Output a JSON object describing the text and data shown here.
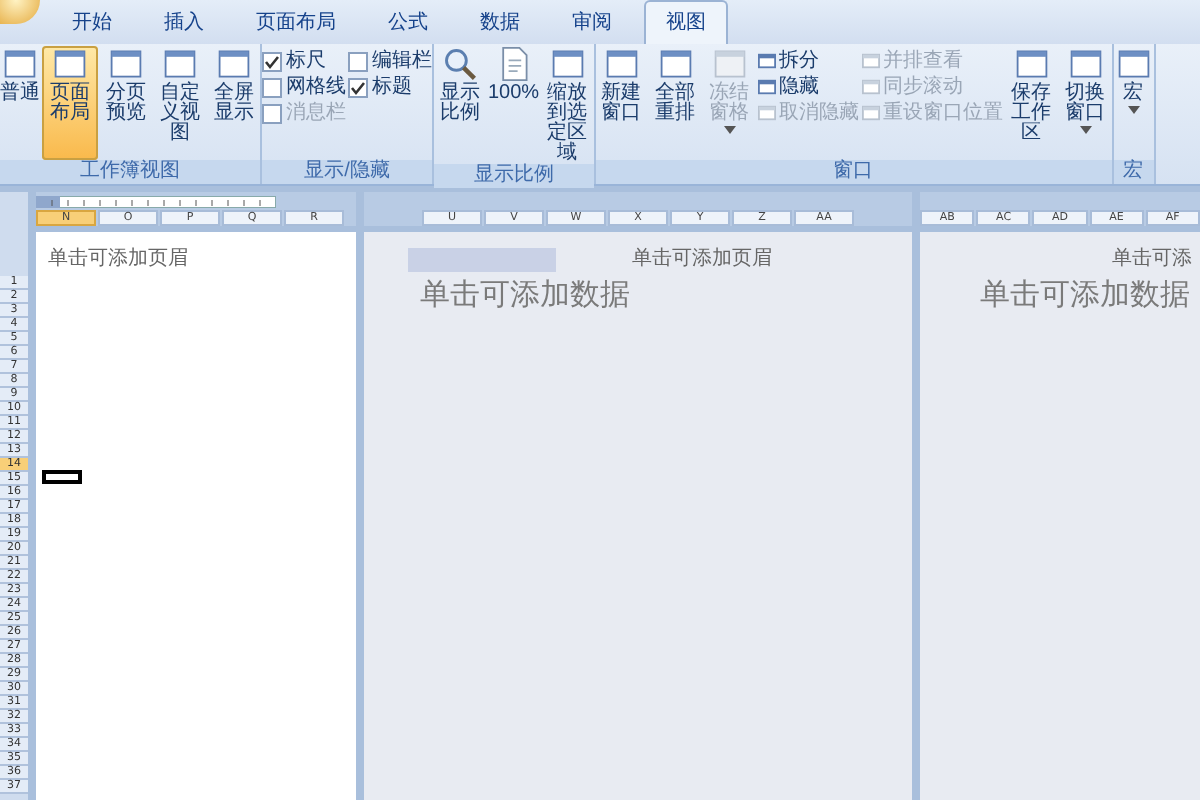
{
  "tabs": [
    {
      "label": "开始",
      "selected": false
    },
    {
      "label": "插入",
      "selected": false
    },
    {
      "label": "页面布局",
      "selected": false
    },
    {
      "label": "公式",
      "selected": false
    },
    {
      "label": "数据",
      "selected": false
    },
    {
      "label": "审阅",
      "selected": false
    },
    {
      "label": "视图",
      "selected": true
    }
  ],
  "ribbon": {
    "groups": [
      {
        "title": "工作簿视图",
        "items": [
          {
            "kind": "large",
            "label": "普通",
            "selected": false,
            "disabled": false
          },
          {
            "kind": "large",
            "label": "页面布局",
            "selected": true,
            "disabled": false
          },
          {
            "kind": "large",
            "label": "分页预览",
            "selected": false,
            "disabled": false
          },
          {
            "kind": "large",
            "label": "自定义视图",
            "selected": false,
            "disabled": false
          },
          {
            "kind": "large",
            "label": "全屏显示",
            "selected": false,
            "disabled": false
          }
        ]
      },
      {
        "title": "显示/隐藏",
        "items": [
          {
            "kind": "checks",
            "entries": [
              {
                "label": "标尺",
                "checked": true,
                "disabled": false
              },
              {
                "label": "网格线",
                "checked": false,
                "disabled": false
              },
              {
                "label": "消息栏",
                "checked": false,
                "disabled": true
              }
            ]
          },
          {
            "kind": "checks",
            "entries": [
              {
                "label": "编辑栏",
                "checked": false,
                "disabled": false
              },
              {
                "label": "标题",
                "checked": true,
                "disabled": false
              }
            ]
          }
        ]
      },
      {
        "title": "显示比例",
        "items": [
          {
            "kind": "large",
            "label": "显示比例",
            "selected": false,
            "disabled": false
          },
          {
            "kind": "large",
            "label": "100%",
            "selected": false,
            "disabled": false
          },
          {
            "kind": "large",
            "label": "缩放到选定区域",
            "selected": false,
            "disabled": false
          }
        ]
      },
      {
        "title": "窗口",
        "items": [
          {
            "kind": "large",
            "label": "新建窗口",
            "selected": false,
            "disabled": false
          },
          {
            "kind": "large",
            "label": "全部重排",
            "selected": false,
            "disabled": false
          },
          {
            "kind": "large",
            "label": "冻结窗格",
            "selected": false,
            "disabled": true,
            "dropdown": true
          },
          {
            "kind": "stack",
            "entries": [
              {
                "label": "拆分",
                "disabled": false
              },
              {
                "label": "隐藏",
                "disabled": false
              },
              {
                "label": "取消隐藏",
                "disabled": true
              }
            ]
          },
          {
            "kind": "stack",
            "entries": [
              {
                "label": "并排查看",
                "disabled": true
              },
              {
                "label": "同步滚动",
                "disabled": true
              },
              {
                "label": "重设窗口位置",
                "disabled": true
              }
            ]
          },
          {
            "kind": "large",
            "label": "保存工作区",
            "selected": false,
            "disabled": false
          },
          {
            "kind": "large",
            "label": "切换窗口",
            "selected": false,
            "disabled": false,
            "dropdown": true
          }
        ]
      },
      {
        "title": "宏",
        "items": [
          {
            "kind": "large",
            "label": "宏",
            "selected": false,
            "disabled": false,
            "dropdown": true
          }
        ]
      }
    ]
  },
  "pages": [
    {
      "active": true,
      "ruler": true,
      "header": "单击可添加页眉",
      "highlight": false,
      "columns": [
        {
          "label": "N",
          "selected": true
        },
        {
          "label": "O",
          "selected": false
        },
        {
          "label": "P",
          "selected": false
        },
        {
          "label": "Q",
          "selected": false
        },
        {
          "label": "R",
          "selected": false
        }
      ]
    },
    {
      "active": false,
      "ruler": false,
      "header": "单击可添加页眉",
      "body": "单击可添加数据",
      "highlight": true,
      "columns": [
        {
          "label": "U",
          "selected": false
        },
        {
          "label": "V",
          "selected": false
        },
        {
          "label": "W",
          "selected": false
        },
        {
          "label": "X",
          "selected": false
        },
        {
          "label": "Y",
          "selected": false
        },
        {
          "label": "Z",
          "selected": false
        },
        {
          "label": "AA",
          "selected": false
        }
      ]
    },
    {
      "active": false,
      "ruler": false,
      "header": "单击可添",
      "body": "单击可添加数据",
      "highlight": false,
      "columns": [
        {
          "label": "AB",
          "selected": false
        },
        {
          "label": "AC",
          "selected": false
        },
        {
          "label": "AD",
          "selected": false
        },
        {
          "label": "AE",
          "selected": false
        },
        {
          "label": "AF",
          "selected": false
        }
      ]
    }
  ],
  "rows": [
    {
      "label": "1",
      "selected": false
    },
    {
      "label": "2",
      "selected": false
    },
    {
      "label": "3",
      "selected": false
    },
    {
      "label": "4",
      "selected": false
    },
    {
      "label": "5",
      "selected": false
    },
    {
      "label": "6",
      "selected": false
    },
    {
      "label": "7",
      "selected": false
    },
    {
      "label": "8",
      "selected": false
    },
    {
      "label": "9",
      "selected": false
    },
    {
      "label": "10",
      "selected": false
    },
    {
      "label": "11",
      "selected": false
    },
    {
      "label": "12",
      "selected": false
    },
    {
      "label": "13",
      "selected": false
    },
    {
      "label": "14",
      "selected": true
    },
    {
      "label": "15",
      "selected": false
    },
    {
      "label": "16",
      "selected": false
    },
    {
      "label": "17",
      "selected": false
    },
    {
      "label": "18",
      "selected": false
    },
    {
      "label": "19",
      "selected": false
    },
    {
      "label": "20",
      "selected": false
    },
    {
      "label": "21",
      "selected": false
    },
    {
      "label": "22",
      "selected": false
    },
    {
      "label": "23",
      "selected": false
    },
    {
      "label": "24",
      "selected": false
    },
    {
      "label": "25",
      "selected": false
    },
    {
      "label": "26",
      "selected": false
    },
    {
      "label": "27",
      "selected": false
    },
    {
      "label": "28",
      "selected": false
    },
    {
      "label": "29",
      "selected": false
    },
    {
      "label": "30",
      "selected": false
    },
    {
      "label": "31",
      "selected": false
    },
    {
      "label": "32",
      "selected": false
    },
    {
      "label": "33",
      "selected": false
    },
    {
      "label": "34",
      "selected": false
    },
    {
      "label": "35",
      "selected": false
    },
    {
      "label": "36",
      "selected": false
    },
    {
      "label": "37",
      "selected": false
    }
  ]
}
